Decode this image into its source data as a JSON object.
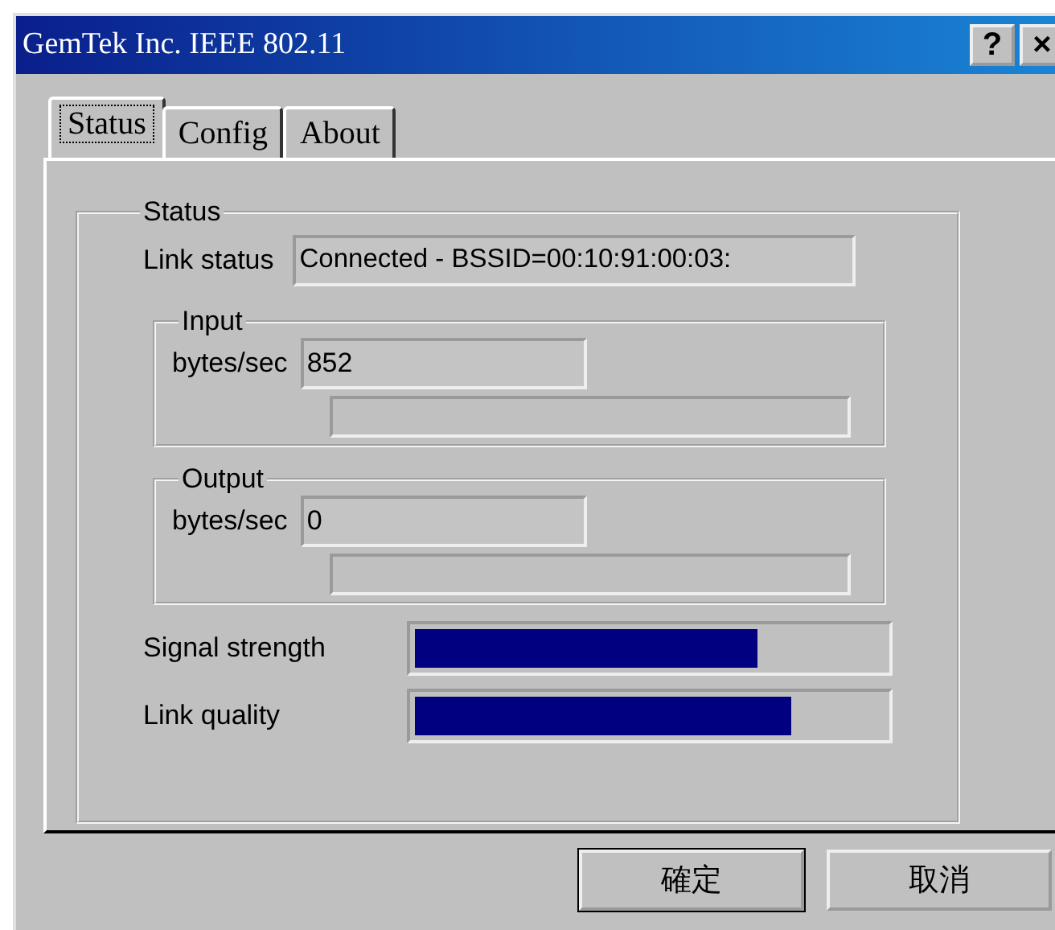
{
  "window": {
    "title": "GemTek Inc. IEEE 802.11",
    "help_button": "?",
    "close_button": "×"
  },
  "tabs": [
    {
      "label": "Status",
      "selected": true
    },
    {
      "label": "Config",
      "selected": false
    },
    {
      "label": "About",
      "selected": false
    }
  ],
  "status_group": {
    "title": "Status",
    "link_status": {
      "label": "Link status",
      "value": "Connected - BSSID=00:10:91:00:03:"
    },
    "traffic": [
      {
        "title": "Input",
        "label": "bytes/sec",
        "value": "852",
        "level": 0
      },
      {
        "title": "Output",
        "label": "bytes/sec",
        "value": "0",
        "level": 0
      }
    ],
    "meters": [
      {
        "label": "Signal strength",
        "level": 0.73
      },
      {
        "label": "Link quality",
        "level": 0.8
      }
    ]
  },
  "buttons": [
    {
      "label": "確定",
      "default": true
    },
    {
      "label": "取消",
      "default": false
    }
  ]
}
